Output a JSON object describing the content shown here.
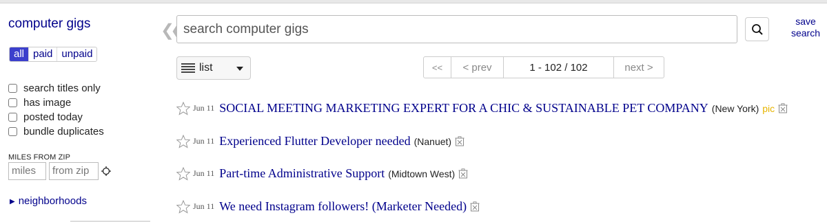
{
  "sidebar": {
    "category_title": "computer gigs",
    "pay_filter": [
      {
        "label": "all",
        "active": true
      },
      {
        "label": "paid",
        "active": false
      },
      {
        "label": "unpaid",
        "active": false
      }
    ],
    "checkboxes": [
      {
        "label": "search titles only",
        "checked": false
      },
      {
        "label": "has image",
        "checked": false
      },
      {
        "label": "posted today",
        "checked": false
      },
      {
        "label": "bundle duplicates",
        "checked": false
      }
    ],
    "miles_label": "MILES FROM ZIP",
    "miles_placeholder": "miles",
    "zip_placeholder": "from zip",
    "neighborhoods_label": "neighborhoods"
  },
  "search": {
    "collapse_icon": "double-chevron-left-icon",
    "placeholder": "search computer gigs",
    "button_icon": "search-icon",
    "save_label": "save search"
  },
  "controls": {
    "view_label": "list",
    "pager": {
      "first": "<<",
      "prev": "< prev",
      "range": "1 - 102 / 102",
      "next": "next >"
    }
  },
  "results": [
    {
      "date": "Jun 11",
      "title": "SOCIAL MEETING MARKETING EXPERT FOR A CHIC & SUSTAINABLE PET COMPANY",
      "hood": "(New York)",
      "pic": "pic"
    },
    {
      "date": "Jun 11",
      "title": "Experienced Flutter Developer needed",
      "hood": "(Nanuet)",
      "pic": ""
    },
    {
      "date": "Jun 11",
      "title": "Part-time Administrative Support",
      "hood": "(Midtown West)",
      "pic": ""
    },
    {
      "date": "Jun 11",
      "title": "We need Instagram followers! (Marketer Needed)",
      "hood": "",
      "pic": ""
    }
  ],
  "colors": {
    "link": "#00008b",
    "active_segment": "#3c40cc",
    "pic_badge": "#e6b400"
  }
}
